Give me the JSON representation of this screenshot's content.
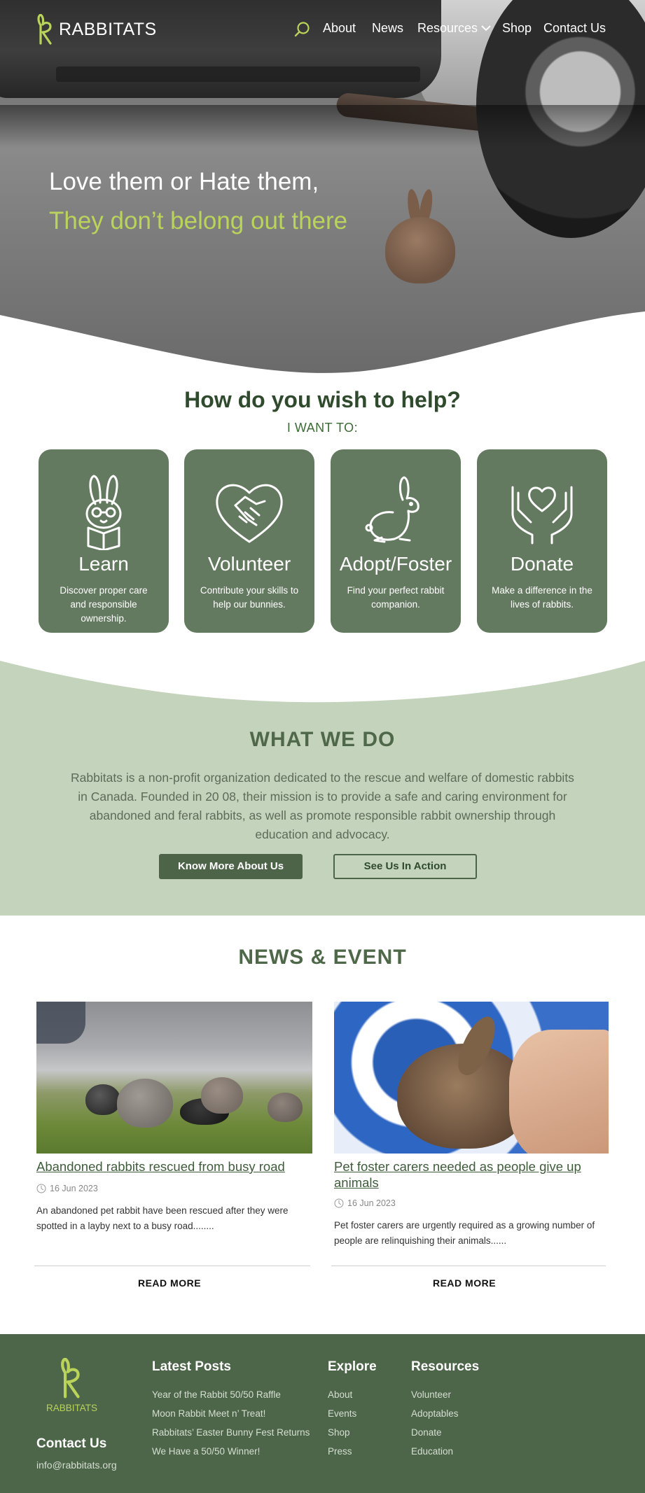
{
  "brand": {
    "name": "RABBITATS",
    "accent": "#b9d35b",
    "primary": "#4d6549"
  },
  "nav": {
    "items": [
      "About",
      "News",
      "Resources",
      "Shop",
      "Contact Us"
    ]
  },
  "hero": {
    "line1": "Love them or Hate them,",
    "line2": "They don’t belong out there"
  },
  "help": {
    "title": "How do you wish to help?",
    "subtitle": "I WANT TO:",
    "cards": [
      {
        "title": "Learn",
        "text": "Discover proper care and responsible ownership.",
        "icon": "reading-rabbit-icon"
      },
      {
        "title": "Volunteer",
        "text": "Contribute your skills to help our bunnies.",
        "icon": "heart-handshake-icon"
      },
      {
        "title": "Adopt/Foster",
        "text": "Find your perfect rabbit companion.",
        "icon": "rabbit-icon"
      },
      {
        "title": "Donate",
        "text": "Make a difference in the lives of rabbits.",
        "icon": "hands-heart-icon"
      }
    ]
  },
  "what_we_do": {
    "title": "WHAT WE DO",
    "text": "Rabbitats is a non-profit organization dedicated to the rescue and welfare of domestic rabbits in Canada. Founded in 20 08, their mission is to provide a safe and caring environment for abandoned and feral rabbits, as well as promote responsible rabbit ownership through education and advocacy.",
    "primary_button": "Know More About Us",
    "secondary_button": "See Us In Action"
  },
  "news": {
    "title": "NEWS & EVENT",
    "posts": [
      {
        "title": "Abandoned rabbits rescued from busy road",
        "date": "16 Jun 2023",
        "excerpt": "An abandoned pet rabbit have been rescued after they were spotted in a layby next to a busy road........",
        "read_more": "READ MORE"
      },
      {
        "title": "Pet foster carers needed as people give up animals",
        "date": "16 Jun 2023",
        "excerpt": "Pet foster carers are urgently required as a growing number of people are relinquishing their animals......",
        "read_more": "READ MORE"
      }
    ]
  },
  "footer": {
    "logo_text": "RABBITATS",
    "contact_heading": "Contact Us",
    "email": "info@rabbitats.org",
    "latest_posts": {
      "heading": "Latest Posts",
      "items": [
        "Year of the Rabbit 50/50 Raffle",
        "Moon Rabbit Meet n’ Treat!",
        "Rabbitats’ Easter Bunny Fest Returns",
        "We Have a 50/50 Winner!"
      ]
    },
    "explore": {
      "heading": "Explore",
      "items": [
        "About",
        "Events",
        "Shop",
        "Press"
      ]
    },
    "resources": {
      "heading": "Resources",
      "items": [
        "Volunteer",
        "Adoptables",
        "Donate",
        "Education"
      ]
    }
  }
}
